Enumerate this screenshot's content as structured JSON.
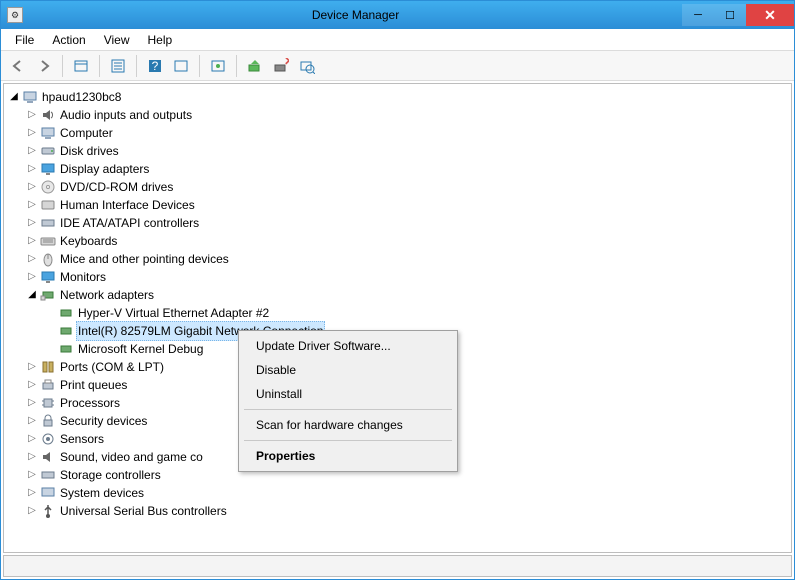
{
  "window": {
    "title": "Device Manager"
  },
  "menubar": {
    "file": "File",
    "action": "Action",
    "view": "View",
    "help": "Help"
  },
  "tree": {
    "root": "hpaud1230bc8",
    "nodes": {
      "audio": "Audio inputs and outputs",
      "computer": "Computer",
      "disk": "Disk drives",
      "display": "Display adapters",
      "dvd": "DVD/CD-ROM drives",
      "hid": "Human Interface Devices",
      "ide": "IDE ATA/ATAPI controllers",
      "keyboard": "Keyboards",
      "mice": "Mice and other pointing devices",
      "monitors": "Monitors",
      "network": "Network adapters",
      "net_hyperv": "Hyper-V Virtual Ethernet Adapter #2",
      "net_intel": "Intel(R) 82579LM Gigabit Network Connection",
      "net_mskd": "Microsoft Kernel Debug",
      "ports": "Ports (COM & LPT)",
      "printq": "Print queues",
      "proc": "Processors",
      "sec": "Security devices",
      "sensors": "Sensors",
      "sound": "Sound, video and game co",
      "storage": "Storage controllers",
      "system": "System devices",
      "usb": "Universal Serial Bus controllers"
    }
  },
  "context_menu": {
    "update": "Update Driver Software...",
    "disable": "Disable",
    "uninstall": "Uninstall",
    "scan": "Scan for hardware changes",
    "properties": "Properties"
  }
}
